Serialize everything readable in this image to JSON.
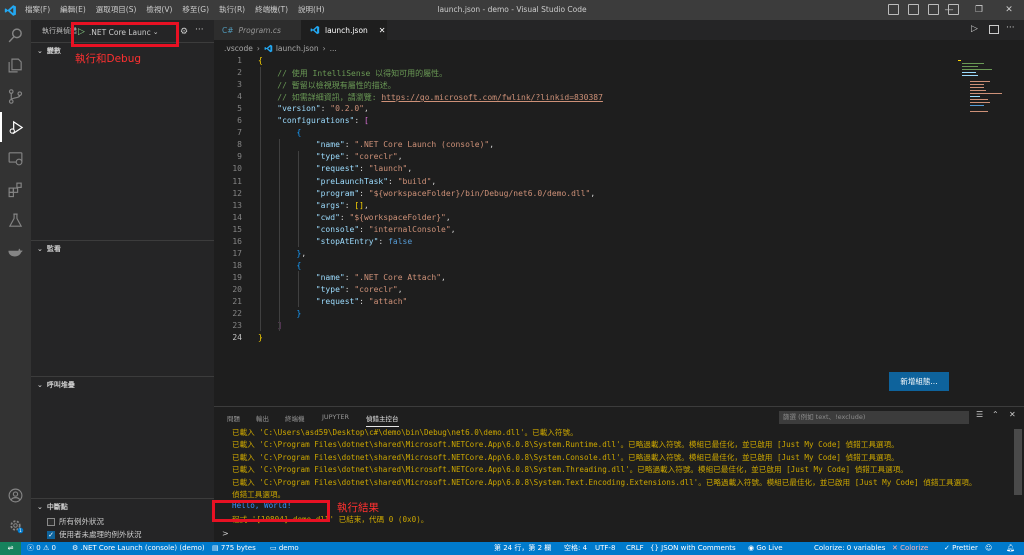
{
  "app": {
    "window_title": "launch.json - demo - Visual Studio Code",
    "menu": [
      "檔案(F)",
      "編輯(E)",
      "選取項目(S)",
      "檢視(V)",
      "移至(G)",
      "執行(R)",
      "終端機(T)",
      "說明(H)"
    ],
    "window_controls": [
      "—",
      "❐",
      "✕"
    ]
  },
  "sidebar": {
    "title": "執行與偵錯",
    "launch_config": ".NET Core Launc",
    "sections": {
      "variables": "變數",
      "watch": "監看",
      "call_stack": "呼叫堆疊",
      "breakpoints": "中斷點"
    },
    "breakpoints": [
      {
        "label": "所有例外狀況",
        "checked": false
      },
      {
        "label": "使用者未處理的例外狀況",
        "checked": true
      }
    ]
  },
  "tabs": [
    {
      "label": "Program.cs",
      "icon": "C#",
      "active": false
    },
    {
      "label": "launch.json",
      "icon": "vscode-icon",
      "active": true
    }
  ],
  "breadcrumb": [
    ".vscode",
    "launch.json",
    "..."
  ],
  "editor": {
    "current_line": 24,
    "lines": [
      [
        [
          "b",
          "{"
        ]
      ],
      [
        [
          "cm",
          "    // 使用 IntelliSense 以得知可用的屬性。"
        ]
      ],
      [
        [
          "cm",
          "    // 暫留以檢視現有屬性的描述。"
        ]
      ],
      [
        [
          "cm",
          "    // 如需詳細資訊，請瀏覽: "
        ],
        [
          "u",
          "https://go.microsoft.com/fwlink/?linkid=830387"
        ]
      ],
      [
        [
          "t",
          "    "
        ],
        [
          "k",
          "\"version\""
        ],
        [
          "t",
          ": "
        ],
        [
          "s",
          "\"0.2.0\""
        ],
        [
          "t",
          ","
        ]
      ],
      [
        [
          "t",
          "    "
        ],
        [
          "k",
          "\"configurations\""
        ],
        [
          "t",
          ": "
        ],
        [
          "p",
          "["
        ]
      ],
      [
        [
          "t",
          "        "
        ],
        [
          "q",
          "{"
        ]
      ],
      [
        [
          "t",
          "            "
        ],
        [
          "k",
          "\"name\""
        ],
        [
          "t",
          ": "
        ],
        [
          "s",
          "\".NET Core Launch (console)\""
        ],
        [
          "t",
          ","
        ]
      ],
      [
        [
          "t",
          "            "
        ],
        [
          "k",
          "\"type\""
        ],
        [
          "t",
          ": "
        ],
        [
          "s",
          "\"coreclr\""
        ],
        [
          "t",
          ","
        ]
      ],
      [
        [
          "t",
          "            "
        ],
        [
          "k",
          "\"request\""
        ],
        [
          "t",
          ": "
        ],
        [
          "s",
          "\"launch\""
        ],
        [
          "t",
          ","
        ]
      ],
      [
        [
          "t",
          "            "
        ],
        [
          "k",
          "\"preLaunchTask\""
        ],
        [
          "t",
          ": "
        ],
        [
          "s",
          "\"build\""
        ],
        [
          "t",
          ","
        ]
      ],
      [
        [
          "t",
          "            "
        ],
        [
          "k",
          "\"program\""
        ],
        [
          "t",
          ": "
        ],
        [
          "s",
          "\"${workspaceFolder}/bin/Debug/net6.0/demo.dll\""
        ],
        [
          "t",
          ","
        ]
      ],
      [
        [
          "t",
          "            "
        ],
        [
          "k",
          "\"args\""
        ],
        [
          "t",
          ": "
        ],
        [
          "b",
          "[]"
        ],
        [
          "t",
          ","
        ]
      ],
      [
        [
          "t",
          "            "
        ],
        [
          "k",
          "\"cwd\""
        ],
        [
          "t",
          ": "
        ],
        [
          "s",
          "\"${workspaceFolder}\""
        ],
        [
          "t",
          ","
        ]
      ],
      [
        [
          "t",
          "            "
        ],
        [
          "k",
          "\"console\""
        ],
        [
          "t",
          ": "
        ],
        [
          "s",
          "\"internalConsole\""
        ],
        [
          "t",
          ","
        ]
      ],
      [
        [
          "t",
          "            "
        ],
        [
          "k",
          "\"stopAtEntry\""
        ],
        [
          "t",
          ": "
        ],
        [
          "kw",
          "false"
        ]
      ],
      [
        [
          "t",
          "        "
        ],
        [
          "q",
          "}"
        ],
        [
          "t",
          ","
        ]
      ],
      [
        [
          "t",
          "        "
        ],
        [
          "q",
          "{"
        ]
      ],
      [
        [
          "t",
          "            "
        ],
        [
          "k",
          "\"name\""
        ],
        [
          "t",
          ": "
        ],
        [
          "s",
          "\".NET Core Attach\""
        ],
        [
          "t",
          ","
        ]
      ],
      [
        [
          "t",
          "            "
        ],
        [
          "k",
          "\"type\""
        ],
        [
          "t",
          ": "
        ],
        [
          "s",
          "\"coreclr\""
        ],
        [
          "t",
          ","
        ]
      ],
      [
        [
          "t",
          "            "
        ],
        [
          "k",
          "\"request\""
        ],
        [
          "t",
          ": "
        ],
        [
          "s",
          "\"attach\""
        ]
      ],
      [
        [
          "t",
          "        "
        ],
        [
          "q",
          "}"
        ]
      ],
      [
        [
          "t",
          "    "
        ],
        [
          "p",
          "]"
        ]
      ],
      [
        [
          "b",
          "}"
        ]
      ]
    ],
    "add_config_button": "新增組態..."
  },
  "panel": {
    "tabs": [
      "問題",
      "輸出",
      "終端機",
      "JUPYTER",
      "偵錯主控台"
    ],
    "active_tab": "偵錯主控台",
    "filter_placeholder": "篩選 (例如 text、!exclude)",
    "output": [
      {
        "text": "已載入 'C:\\Users\\asd59\\Desktop\\c#\\demo\\bin\\Debug\\net6.0\\demo.dll'。已載入符號。",
        "color": "#cca700"
      },
      {
        "text": "已載入 'C:\\Program Files\\dotnet\\shared\\Microsoft.NETCore.App\\6.0.8\\System.Runtime.dll'。已略過載入符號。模組已最佳化，並已啟用 [Just My Code] 偵錯工具選項。",
        "color": "#cca700"
      },
      {
        "text": "已載入 'C:\\Program Files\\dotnet\\shared\\Microsoft.NETCore.App\\6.0.8\\System.Console.dll'。已略過載入符號。模組已最佳化，並已啟用 [Just My Code] 偵錯工具選項。",
        "color": "#cca700"
      },
      {
        "text": "已載入 'C:\\Program Files\\dotnet\\shared\\Microsoft.NETCore.App\\6.0.8\\System.Threading.dll'。已略過載入符號。模組已最佳化，並已啟用 [Just My Code] 偵錯工具選項。",
        "color": "#cca700"
      },
      {
        "text": "已載入 'C:\\Program Files\\dotnet\\shared\\Microsoft.NETCore.App\\6.0.8\\System.Text.Encoding.Extensions.dll'。已略過載入符號。模組已最佳化，並已啟用 [Just My Code] 偵錯工具選項。",
        "color": "#cca700"
      },
      {
        "text": "偵錯工具選項。",
        "color": "#cca700"
      },
      {
        "text": "Hello, World!",
        "color": "#3794ff"
      },
      {
        "text": "程式 '[10804] demo.dll' 已結束，代碼 0 (0x0)。",
        "color": "#cca700"
      }
    ],
    "prompt": ">"
  },
  "statusbar": {
    "errors": "0",
    "warnings": "0",
    "launch_label": ".NET Core Launch (console) (demo)",
    "file_size": "775 bytes",
    "folder": "demo",
    "position": "第 24 行，第 2 欄",
    "spaces": "空格: 4",
    "encoding": "UTF-8",
    "eol": "CRLF",
    "language": "JSON with Comments",
    "go_live": "Go Live",
    "colorize_vars": "Colorize: 0 variables",
    "colorize": "Colorize",
    "prettier": "Prettier"
  },
  "annotations": {
    "run_debug": "執行和Debug",
    "result": "執行結果"
  },
  "colors": {
    "accent": "#007acc",
    "annotation_red": "#e81123"
  }
}
